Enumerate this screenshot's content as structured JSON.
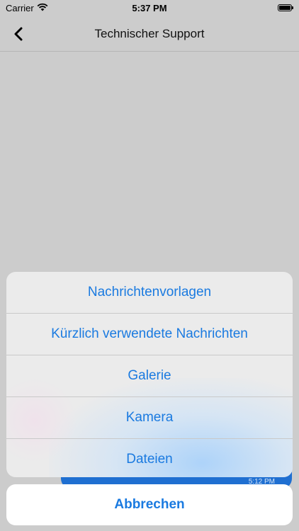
{
  "status_bar": {
    "carrier": "Carrier",
    "time": "5:37 PM"
  },
  "nav": {
    "title": "Technischer Support"
  },
  "chat": {
    "last_time": "5:12 PM"
  },
  "action_sheet": {
    "items": [
      {
        "label": "Nachrichtenvorlagen"
      },
      {
        "label": "Kürzlich verwendete Nachrichten"
      },
      {
        "label": "Galerie"
      },
      {
        "label": "Kamera"
      },
      {
        "label": "Dateien"
      }
    ],
    "cancel_label": "Abbrechen"
  },
  "colors": {
    "accent": "#1a7ae0",
    "dim_background": "#cccccc"
  }
}
